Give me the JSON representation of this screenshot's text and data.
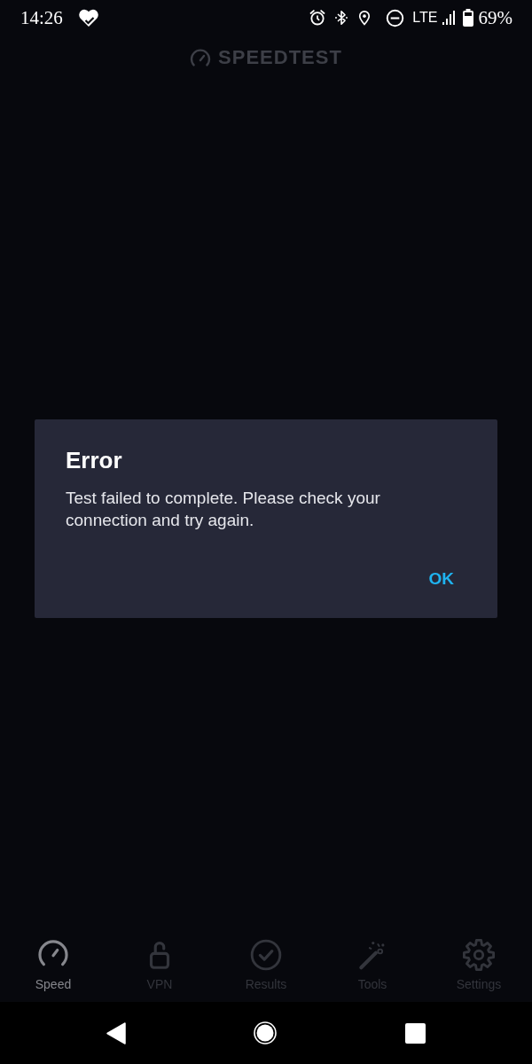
{
  "status_bar": {
    "time": "14:26",
    "network": "LTE",
    "battery": "69%"
  },
  "header": {
    "title": "SPEEDTEST"
  },
  "dialog": {
    "title": "Error",
    "message": "Test failed to complete. Please check your connection and try again.",
    "buttons": [
      "OK"
    ]
  },
  "tabs": [
    {
      "kind": "speed",
      "label": "Speed",
      "selected": true
    },
    {
      "kind": "vpn",
      "label": "VPN",
      "selected": false
    },
    {
      "kind": "results",
      "label": "Results",
      "selected": false
    },
    {
      "kind": "tools",
      "label": "Tools",
      "selected": false
    },
    {
      "kind": "settings",
      "label": "Settings",
      "selected": false
    }
  ]
}
